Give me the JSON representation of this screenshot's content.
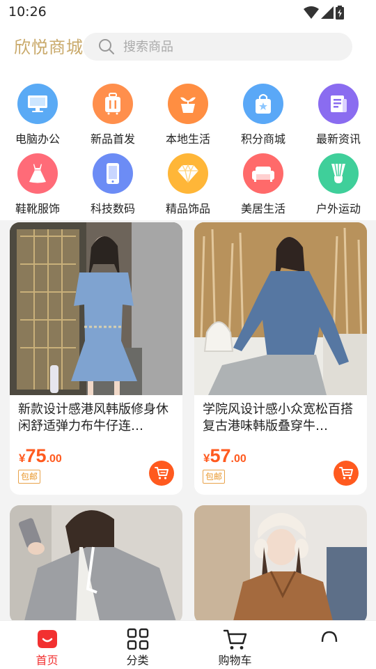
{
  "status": {
    "time": "10:26"
  },
  "header": {
    "logo": "欣悦商城",
    "search_placeholder": "搜索商品"
  },
  "categories": [
    {
      "label": "电脑办公",
      "icon": "monitor-icon",
      "color": "#5aaaf5"
    },
    {
      "label": "新品首发",
      "icon": "suitcase-icon",
      "color": "#ff8f4c"
    },
    {
      "label": "本地生活",
      "icon": "plant-pot-icon",
      "color": "#ff8e42"
    },
    {
      "label": "积分商城",
      "icon": "shopping-bag-icon",
      "color": "#5aa8f7"
    },
    {
      "label": "最新资讯",
      "icon": "news-icon",
      "color": "#8a6cf0"
    },
    {
      "label": "鞋靴服饰",
      "icon": "dress-icon",
      "color": "#ff6b78"
    },
    {
      "label": "科技数码",
      "icon": "phone-icon",
      "color": "#6c8cf5"
    },
    {
      "label": "精品饰品",
      "icon": "diamond-icon",
      "color": "#ffb638"
    },
    {
      "label": "美居生活",
      "icon": "sofa-icon",
      "color": "#ff6a6a"
    },
    {
      "label": "户外运动",
      "icon": "badminton-icon",
      "color": "#3fcf9a"
    }
  ],
  "products": [
    {
      "title": "新款设计感港风韩版修身休闲舒适弹力布牛仔连…",
      "currency": "¥",
      "price_int": "75",
      "price_dec": ".00",
      "badge": "包邮"
    },
    {
      "title": "学院风设计感小众宽松百搭复古港味韩版叠穿牛…",
      "currency": "¥",
      "price_int": "57",
      "price_dec": ".00",
      "badge": "包邮"
    },
    {
      "title": "",
      "currency": "",
      "price_int": "",
      "price_dec": "",
      "badge": ""
    },
    {
      "title": "",
      "currency": "",
      "price_int": "",
      "price_dec": "",
      "badge": ""
    }
  ],
  "nav": [
    {
      "label": "首页",
      "icon": "home-icon",
      "active": true
    },
    {
      "label": "分类",
      "icon": "grid-icon"
    },
    {
      "label": "购物车",
      "icon": "cart-icon"
    },
    {
      "label": "",
      "icon": "user-icon"
    }
  ],
  "colors": {
    "accent": "#ff5a1f",
    "nav_active": "#f23030",
    "logo": "#c9a96a",
    "badge": "#e8962a"
  }
}
